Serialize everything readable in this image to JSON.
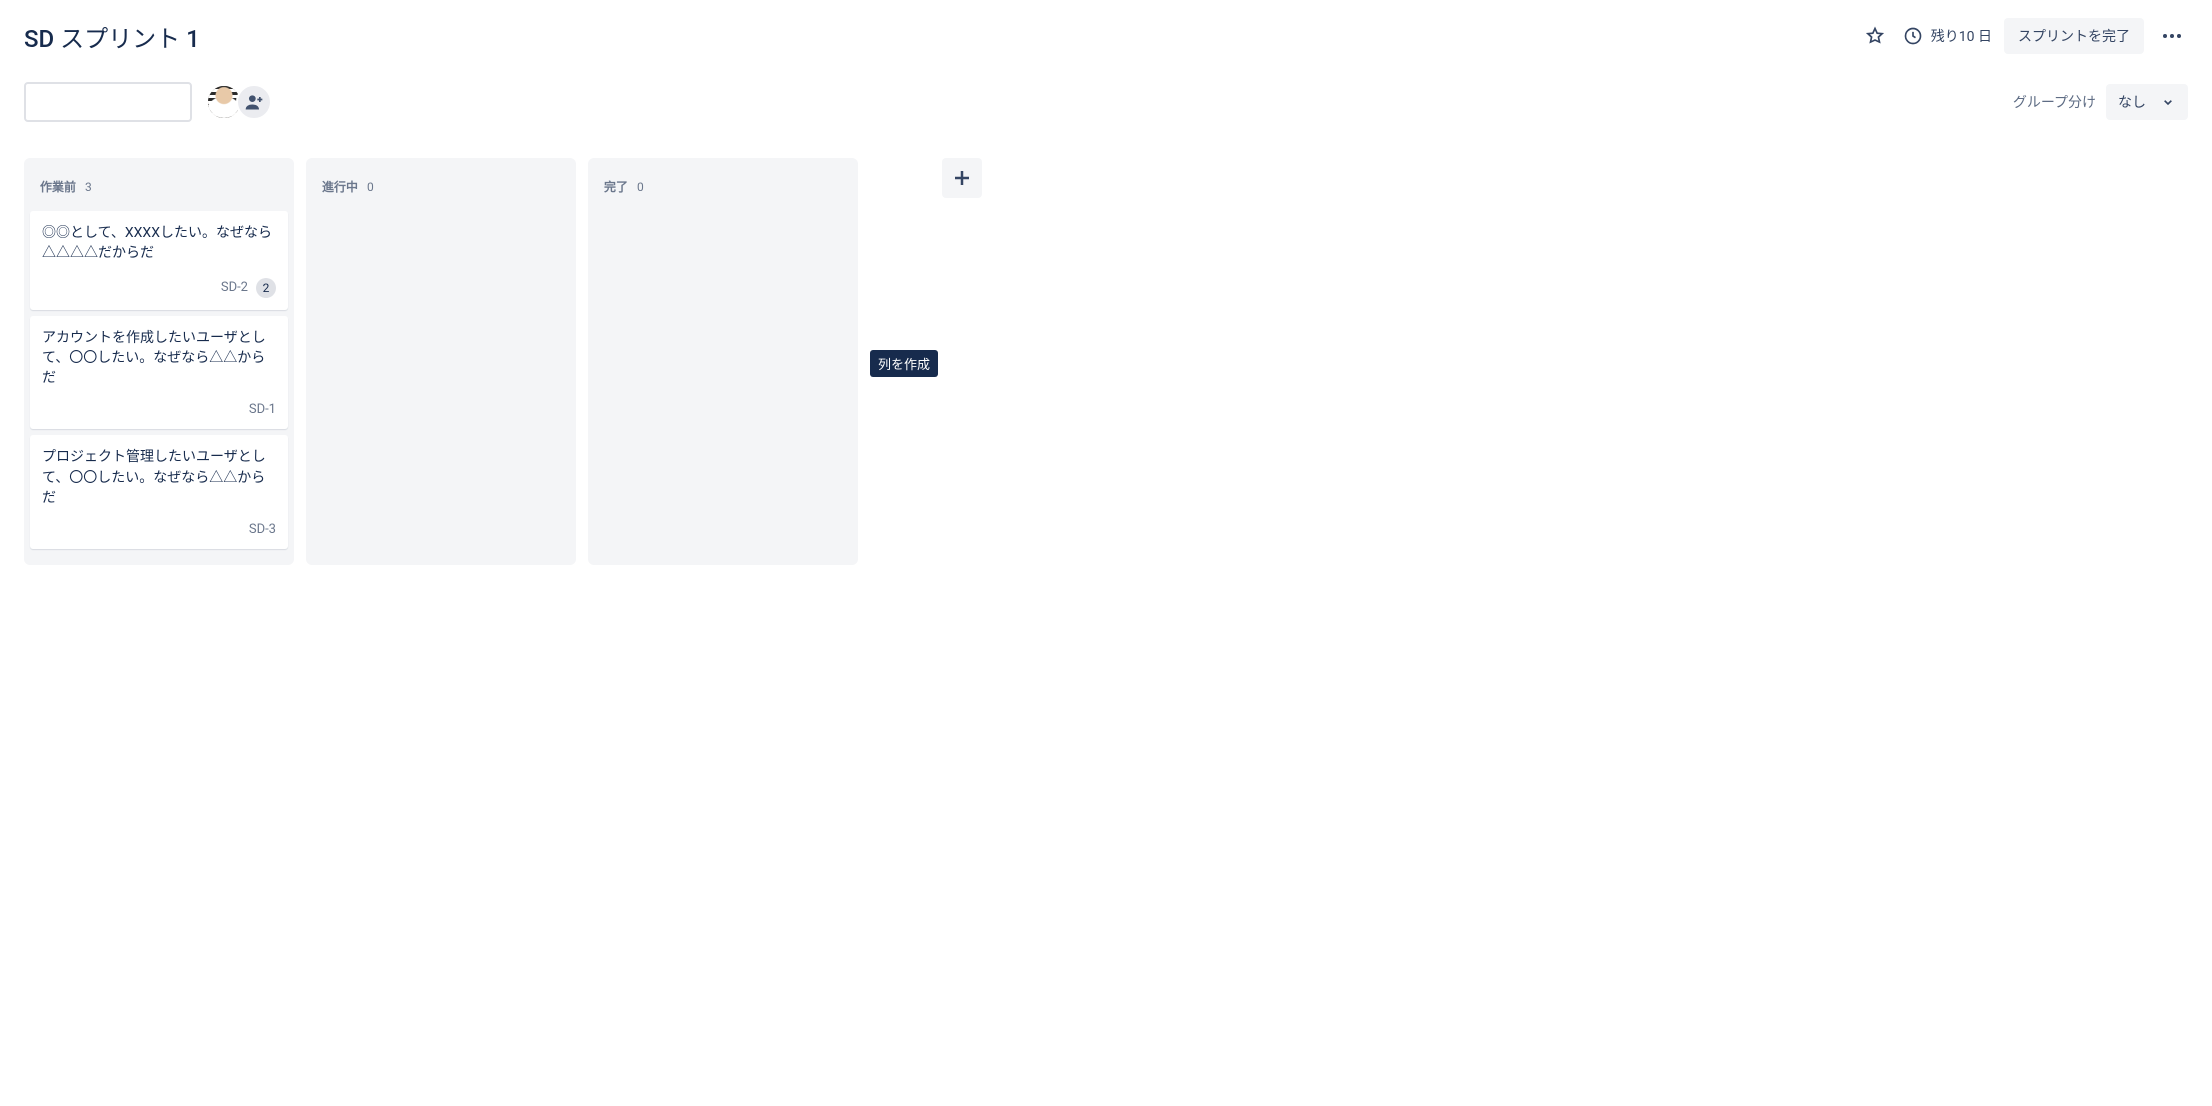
{
  "header": {
    "title": "SD スプリント 1",
    "remaining_label": "残り10 日",
    "complete_sprint_label": "スプリントを完了"
  },
  "toolbar": {
    "search_placeholder": "",
    "group_by_label": "グループ分け",
    "group_by_value": "なし"
  },
  "board": {
    "columns": [
      {
        "id": "todo",
        "title": "作業前",
        "count": 3
      },
      {
        "id": "inprogress",
        "title": "進行中",
        "count": 0
      },
      {
        "id": "done",
        "title": "完了",
        "count": 0
      }
    ],
    "cards": {
      "todo": [
        {
          "title": "◎◎として、XXXXしたい。なぜなら△△△△だからだ",
          "key": "SD-2",
          "estimate": "2"
        },
        {
          "title": "アカウントを作成したいユーザとして、〇〇したい。なぜなら△△からだ",
          "key": "SD-1",
          "estimate": null
        },
        {
          "title": "プロジェクト管理したいユーザとして、〇〇したい。なぜなら△△からだ",
          "key": "SD-3",
          "estimate": null
        }
      ]
    },
    "add_column_tooltip": "列を作成"
  },
  "icons": {
    "star": "star-icon",
    "clock": "clock-icon",
    "more": "more-icon",
    "search": "search-icon",
    "add_person": "add-person-icon",
    "chevron_down": "chevron-down-icon",
    "plus": "plus-icon"
  }
}
